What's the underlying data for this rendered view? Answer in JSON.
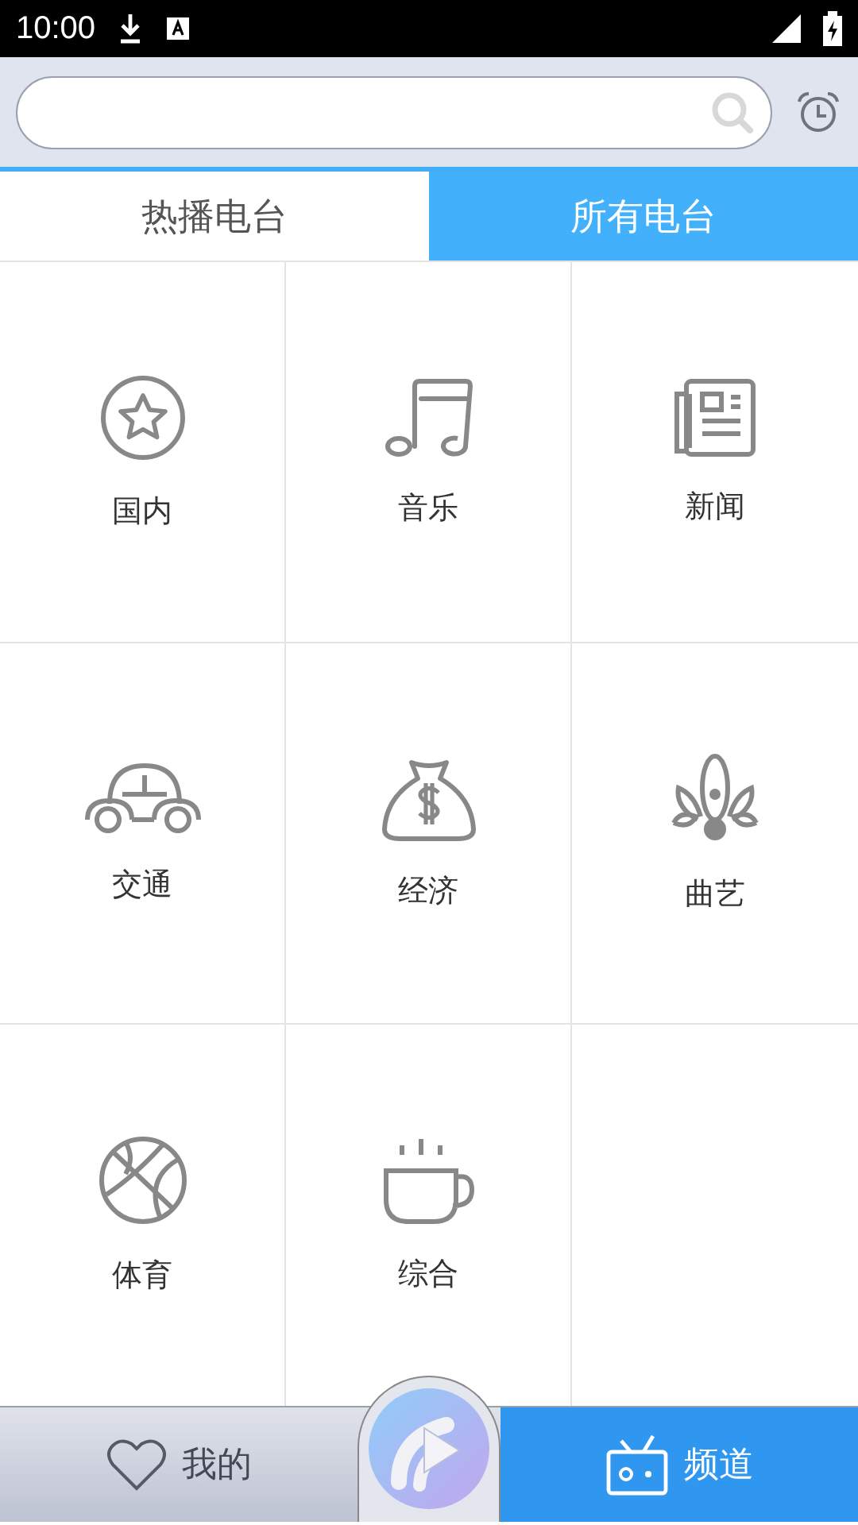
{
  "status_bar": {
    "time": "10:00"
  },
  "tabs": [
    {
      "label": "热播电台",
      "selected": false
    },
    {
      "label": "所有电台",
      "selected": true
    }
  ],
  "categories": [
    {
      "label": "国内",
      "kind": "star"
    },
    {
      "label": "音乐",
      "kind": "music"
    },
    {
      "label": "新闻",
      "kind": "news"
    },
    {
      "label": "交通",
      "kind": "car"
    },
    {
      "label": "经济",
      "kind": "money"
    },
    {
      "label": "曲艺",
      "kind": "opera"
    },
    {
      "label": "体育",
      "kind": "ball"
    },
    {
      "label": "综合",
      "kind": "cup"
    }
  ],
  "bottom_nav": [
    {
      "label": "我的",
      "kind": "heart",
      "selected": false
    },
    {
      "label": "频道",
      "kind": "radio",
      "selected": true
    }
  ]
}
